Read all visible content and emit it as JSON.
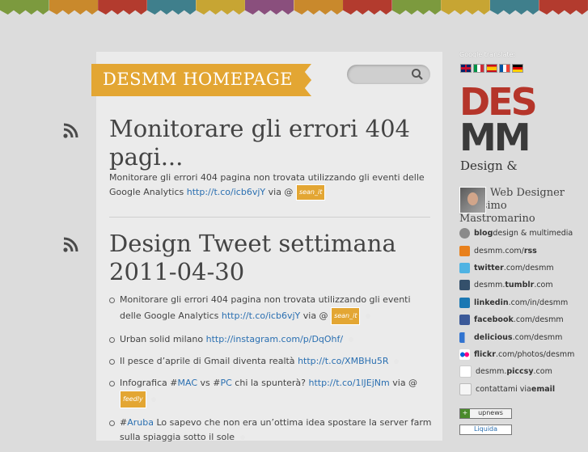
{
  "header": {
    "site_title": "DESMM HOMEPAGE",
    "search_placeholder": ""
  },
  "posts": [
    {
      "title": "Monitorare gli errori 404 pagi...",
      "excerpt_text": "Monitorare gli errori 404 pagina non trovata utilizzando gli eventi delle Google Analytics",
      "link": "http://t.co/icb6vjY",
      "via": "via @",
      "tag": "sean_it"
    },
    {
      "title_line1": "Design Tweet settimana",
      "title_line2": "2011-04-30"
    }
  ],
  "tweets": [
    {
      "text": "Monitorare gli errori 404 pagina non trovata utilizzando gli eventi delle Google Analytics",
      "link": "http://t.co/icb6vjY",
      "via": "via @",
      "tag": "sean_it"
    },
    {
      "text": "Urban solid milano",
      "link": "http://instagram.com/p/DqOhf/"
    },
    {
      "text": "Il pesce d’aprile di Gmail diventa realtà",
      "link": "http://t.co/XMBHu5R"
    },
    {
      "pre": "Infografica #",
      "hash1": "MAC",
      "mid": " vs #",
      "hash2": "PC",
      "post": " chi la spunterà?",
      "link": "http://t.co/1lJEjNm",
      "via": "via @",
      "tag": "feedly"
    },
    {
      "pre": "#",
      "hash1": "Aruba",
      "post": " Lo sapevo che non era un’ottima idea spostare la server farm sulla spiaggia sotto il sole"
    }
  ],
  "sidebar": {
    "translate_label": "Google translate:",
    "logo_line1": "DES",
    "logo_line2": "MM",
    "tagline": "Design &",
    "profile_text": "Web Designer Massimo Mastromarino",
    "links": [
      {
        "icon": "wordpress-icon",
        "bold": "blog",
        "rest": " design & multimedia",
        "color": "#8a8a8a"
      },
      {
        "icon": "rss-icon",
        "pre": "desmm.com/",
        "bold": "rss",
        "color": "#e8801c"
      },
      {
        "icon": "twitter-icon",
        "bold": "twitter",
        "rest": ".com/desmm",
        "color": "#4fb3e3"
      },
      {
        "icon": "tumblr-icon",
        "pre": "desmm.",
        "bold": "tumblr",
        "rest": ".com",
        "color": "#34506b"
      },
      {
        "icon": "linkedin-icon",
        "bold": "linkedin",
        "rest": ".com/in/desmm",
        "color": "#1b78b3"
      },
      {
        "icon": "facebook-icon",
        "bold": "facebook",
        "rest": ".com/desmm",
        "color": "#3b5998"
      },
      {
        "icon": "delicious-icon",
        "bold": "delicious",
        "rest": ".com/desmm",
        "color": "#3274d0"
      },
      {
        "icon": "flickr-icon",
        "bold": "flickr",
        "rest": ".com/photos/desmm",
        "color": "#ff0084"
      },
      {
        "icon": "piccsy-icon",
        "pre": "desmm.",
        "bold": "piccsy",
        "rest": ".com",
        "color": "#d33"
      },
      {
        "icon": "mail-icon",
        "pre": "contattami via ",
        "bold": "email",
        "color": "#bbb"
      }
    ],
    "badge1": "upnews",
    "badge2": "Liquida"
  },
  "colors": {
    "accent": "#e3a633",
    "link": "#2a6fb1",
    "rss": "#4a4a4a"
  }
}
